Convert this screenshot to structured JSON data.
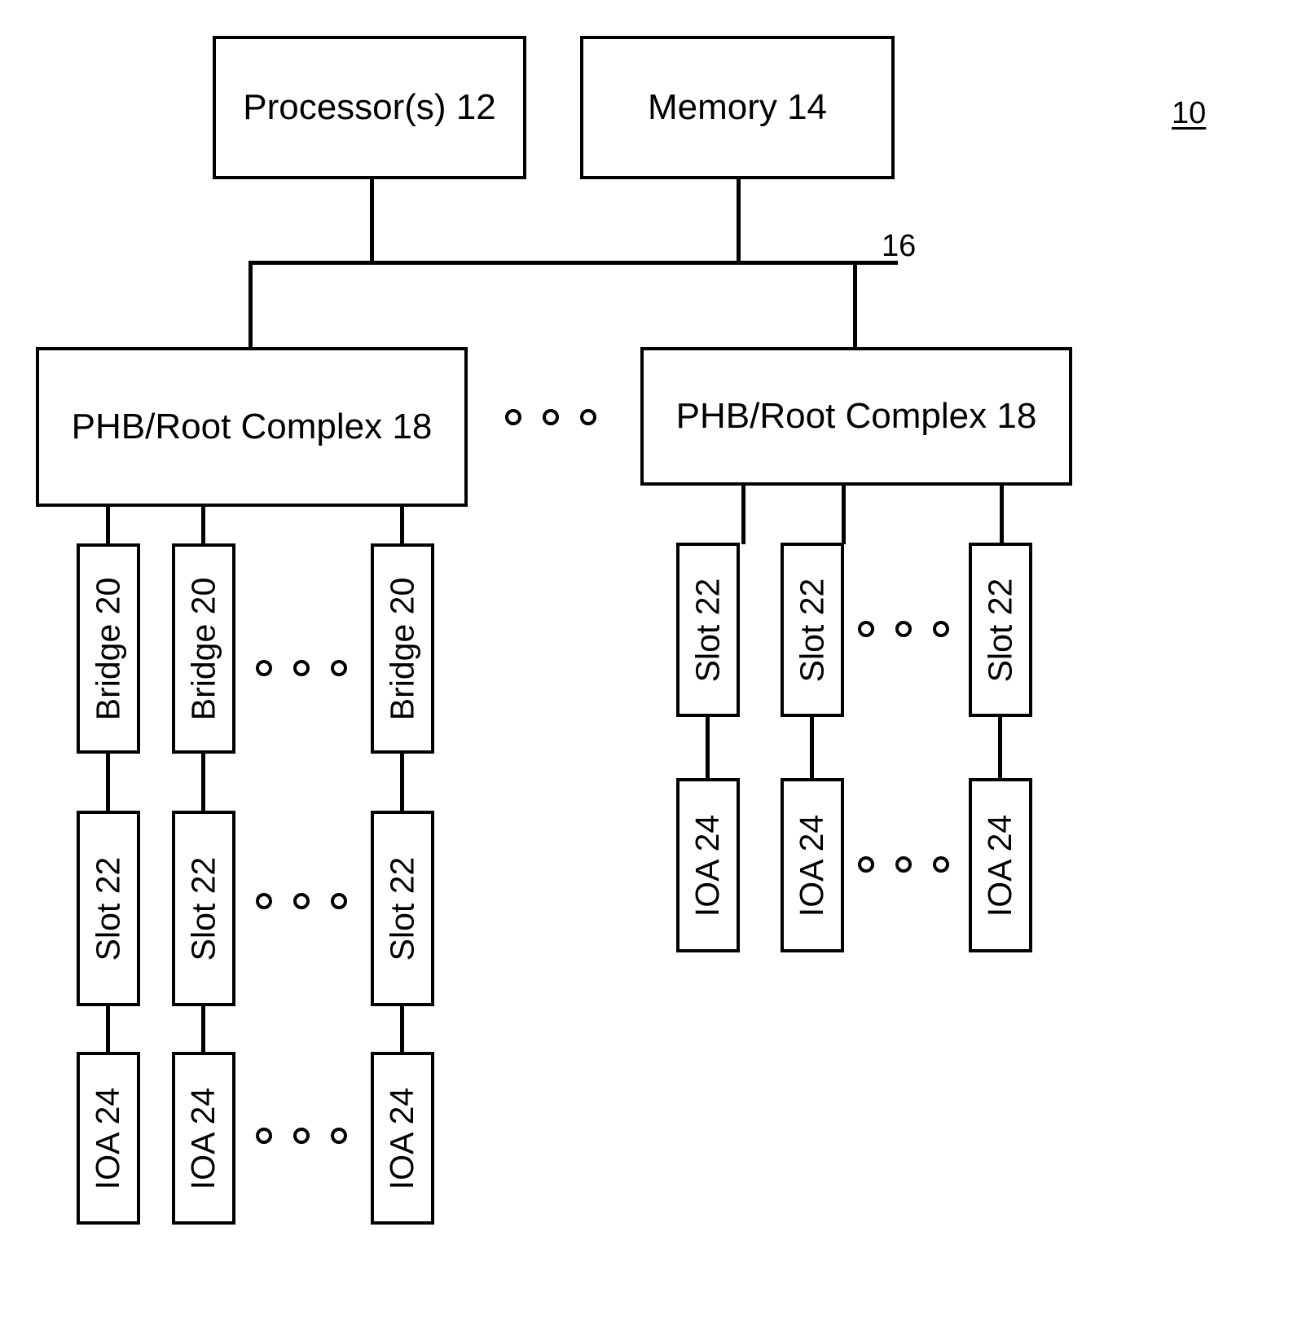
{
  "figure": {
    "reference_numeral": "10",
    "bus_label": "16",
    "top_boxes": [
      {
        "label": "Processor(s) 12"
      },
      {
        "label": "Memory 14"
      }
    ],
    "phb_boxes": [
      {
        "label": "PHB/Root Complex 18"
      },
      {
        "label": "PHB/Root Complex 18"
      }
    ],
    "left_branch": {
      "bridge_row": [
        {
          "label": "Bridge 20"
        },
        {
          "label": "Bridge 20"
        },
        {
          "label": "Bridge 20"
        }
      ],
      "slot_row": [
        {
          "label": "Slot 22"
        },
        {
          "label": "Slot 22"
        },
        {
          "label": "Slot 22"
        }
      ],
      "ioa_row": [
        {
          "label": "IOA 24"
        },
        {
          "label": "IOA 24"
        },
        {
          "label": "IOA 24"
        }
      ]
    },
    "right_branch": {
      "slot_row": [
        {
          "label": "Slot 22"
        },
        {
          "label": "Slot 22"
        },
        {
          "label": "Slot 22"
        }
      ],
      "ioa_row": [
        {
          "label": "IOA 24"
        },
        {
          "label": "IOA 24"
        },
        {
          "label": "IOA 24"
        }
      ]
    }
  }
}
